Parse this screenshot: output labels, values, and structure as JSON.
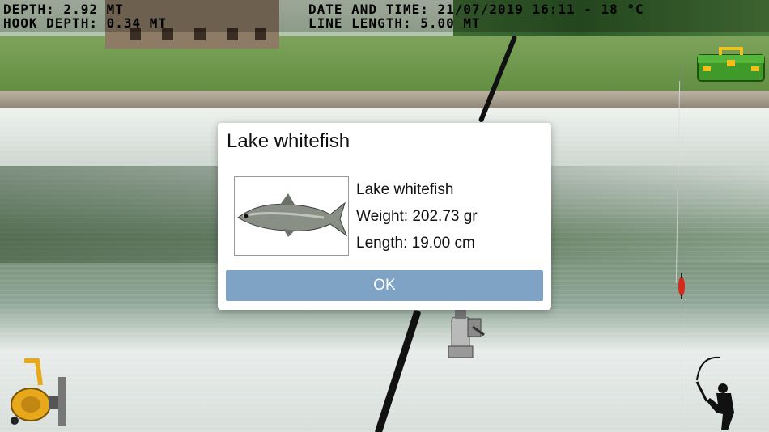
{
  "hud": {
    "depth": "DEPTH: 2.92 MT",
    "hook_depth": "HOOK DEPTH: 0.34 MT",
    "date_time": "DATE AND TIME: 21/07/2019 16:11 - 18 °C",
    "line_length": "LINE LENGTH: 5.00 MT"
  },
  "dialog": {
    "title": "Lake whitefish",
    "fish_name": "Lake whitefish",
    "weight": "Weight: 202.73 gr",
    "length": "Length: 19.00 cm",
    "ok_label": "OK"
  },
  "icons": [
    "tackle-box-icon",
    "reel-icon",
    "fisherman-icon",
    "float-icon"
  ],
  "colors": {
    "ok_button": "#7fa3c4",
    "tackle_box": "#3f9a2a",
    "reel": "#e8a81c",
    "float": "#d42a1a"
  }
}
